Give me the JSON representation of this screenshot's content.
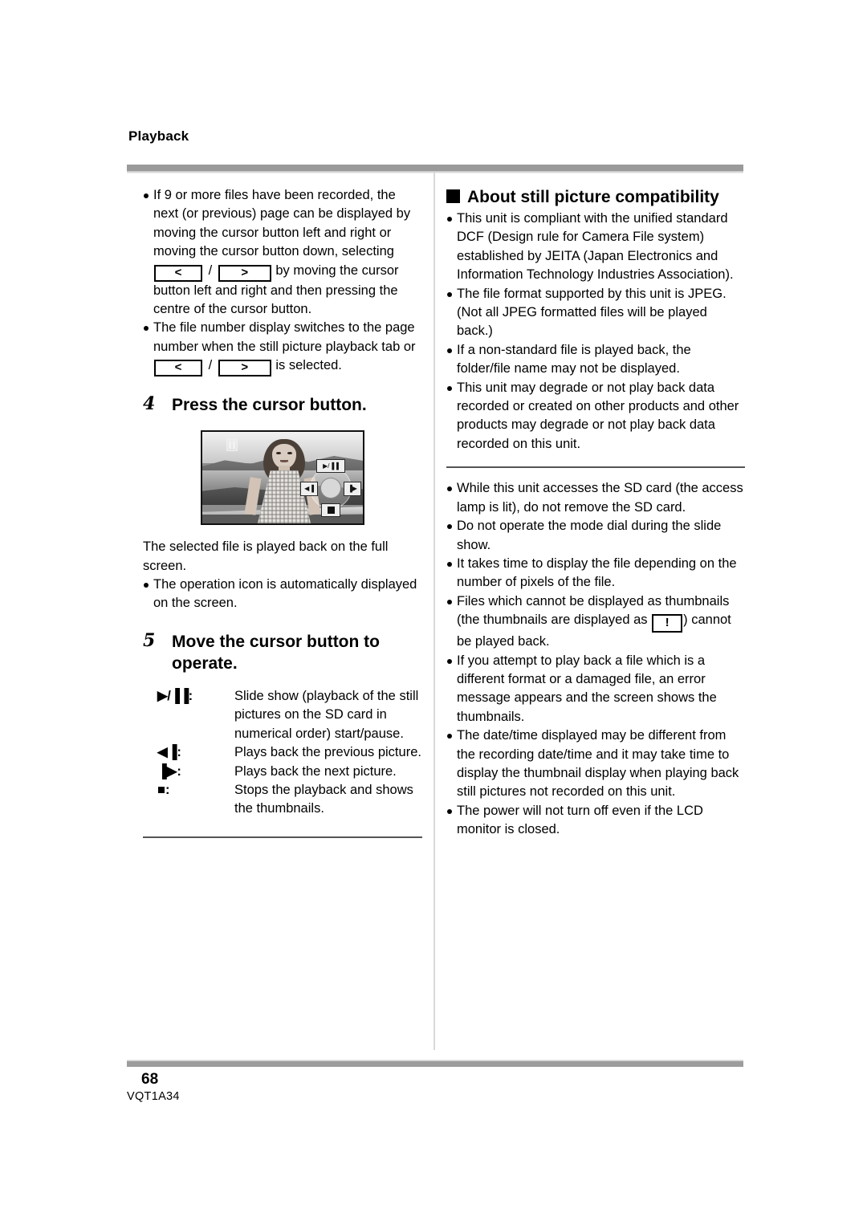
{
  "running_head": "Playback",
  "left_column": {
    "intro_bullets": [
      {
        "parts": [
          "If 9 or more files have been recorded, the next (or previous) page can be displayed by moving the cursor button left and right or moving the cursor button down, selecting ",
          "KEY_LT",
          " / ",
          "KEY_GT",
          " by moving the cursor button left and right and then pressing the centre of the cursor button."
        ]
      },
      {
        "parts": [
          "The file number display switches to the page number when the still picture playback tab or ",
          "KEY_LT",
          " / ",
          "KEY_GT",
          " is selected."
        ]
      }
    ],
    "step4": {
      "number": "4",
      "title": "Press the cursor button."
    },
    "figure": {
      "pause_icon": "pause-icon",
      "cursor_pad": {
        "up_label": "▶/▐▐",
        "left_label": "◀▐",
        "right_label": "▐▶",
        "down_label": "stop-square"
      }
    },
    "after_figure_text": "The selected file is played back on the full screen.",
    "after_figure_bullets": [
      "The operation icon is automatically displayed on the screen."
    ],
    "step5": {
      "number": "5",
      "title": "Move the cursor button to operate."
    },
    "operations": [
      {
        "symbol": "▶/▐▐",
        "symbol_name": "play-pause-icon",
        "colon": ":",
        "description": "Slide show (playback of the still pictures on the SD card in numerical order) start/pause."
      },
      {
        "symbol": "◀▐",
        "symbol_name": "previous-picture-icon",
        "colon": ":",
        "description": "Plays back the previous picture."
      },
      {
        "symbol": "▐▶",
        "symbol_name": "next-picture-icon",
        "colon": ":",
        "description": "Plays back the next picture."
      },
      {
        "symbol": "■",
        "symbol_name": "stop-icon",
        "colon": ":",
        "description": "Stops the playback and shows the thumbnails."
      }
    ]
  },
  "right_column": {
    "heading": "About still picture compatibility",
    "compat_bullets": [
      "This unit is compliant with the unified standard DCF (Design rule for Camera File system) established by JEITA (Japan Electronics and Information Technology Industries Association).",
      "The file format supported by this unit is JPEG. (Not all JPEG formatted files will be played back.)",
      "If a non-standard file is played back, the folder/file name may not be displayed.",
      "This unit may degrade or not play back data recorded or created on other products and other products may degrade or not play back data recorded on this unit."
    ],
    "notes_bullets_pre": [
      "While this unit accesses the SD card (the access lamp is lit), do not remove the SD card.",
      "Do not operate the mode dial during the slide show.",
      "It takes time to display the file depending on the number of pixels of the file."
    ],
    "thumbnail_bullet": {
      "before": "Files which cannot be displayed as thumbnails (the thumbnails are displayed as ",
      "glyph": "!",
      "after": ") cannot be played back."
    },
    "notes_bullets_post": [
      "If you attempt to play back a file which is a different format or a damaged file, an error message appears and the screen shows the thumbnails.",
      "The date/time displayed may be different from the recording date/time and it may take time to display the thumbnail display when playing back still pictures not recorded on this unit.",
      "The power will not turn off even if the LCD monitor is closed."
    ]
  },
  "footer": {
    "page_number": "68",
    "doc_code": "VQT1A34"
  },
  "keys": {
    "left_arrow": "<",
    "right_arrow": ">"
  },
  "colors": {
    "band_dark": "#9a9a9a",
    "band_light": "#dcdcdc",
    "divider": "#d8d8d8",
    "rule": "#555555",
    "text": "#000000"
  }
}
